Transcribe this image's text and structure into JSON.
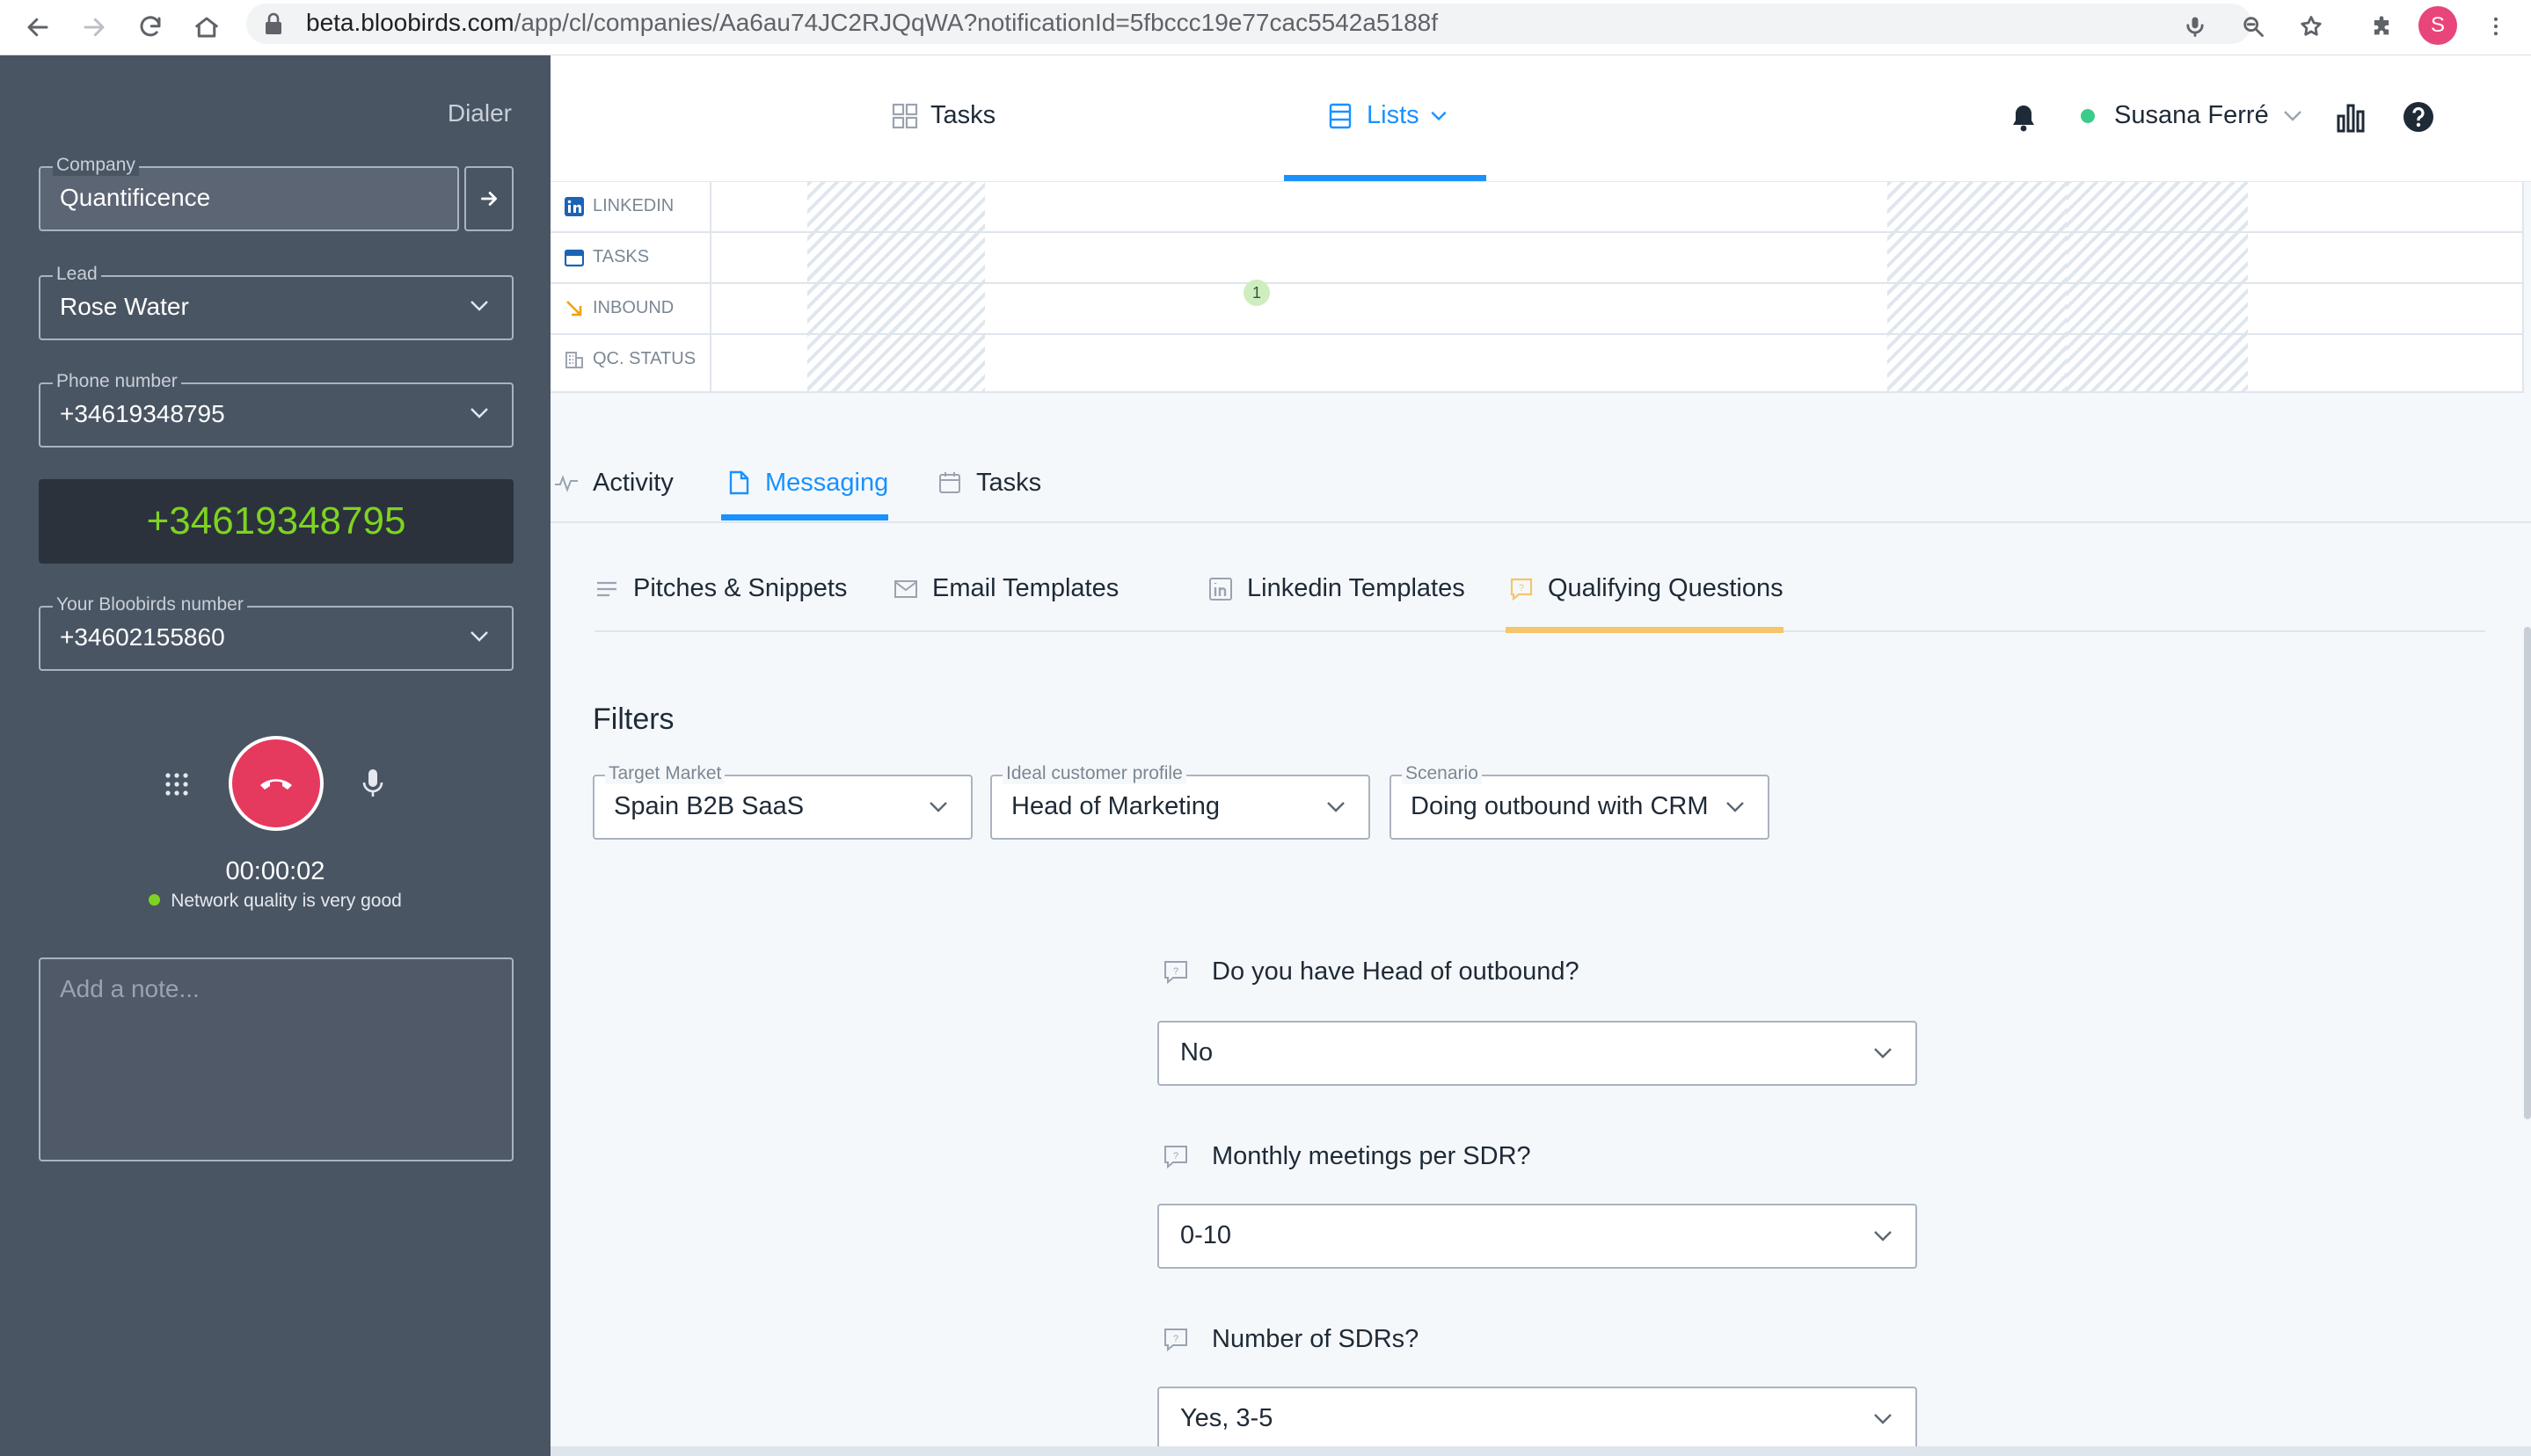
{
  "browser": {
    "url_host": "beta.bloobirds.com",
    "url_path": "/app/cl/companies/Aa6au74JC2RJQqWA?notificationId=5fbccc19e77cac5542a5188f",
    "profile_initial": "S"
  },
  "dialer": {
    "title": "Dialer",
    "company": {
      "label": "Company",
      "value": "Quantificence"
    },
    "lead": {
      "label": "Lead",
      "value": "Rose Water"
    },
    "phone": {
      "label": "Phone number",
      "value": "+34619348795"
    },
    "display_number": "+34619348795",
    "own_number": {
      "label": "Your Bloobirds number",
      "value": "+34602155860"
    },
    "timer": "00:00:02",
    "network_status": "Network quality is very good",
    "note_placeholder": "Add a note..."
  },
  "topnav": {
    "tasks_label": "Tasks",
    "lists_label": "Lists",
    "user_name": "Susana Ferré"
  },
  "timeline": {
    "rows": [
      "LINKEDIN",
      "TASKS",
      "INBOUND",
      "QC. STATUS"
    ],
    "badge": "1"
  },
  "content_tabs": {
    "activity": "Activity",
    "messaging": "Messaging",
    "tasks": "Tasks"
  },
  "sub_tabs": {
    "pitches": "Pitches & Snippets",
    "email": "Email Templates",
    "linkedin": "Linkedin Templates",
    "qualifying": "Qualifying Questions"
  },
  "filters": {
    "title": "Filters",
    "target_market": {
      "label": "Target Market",
      "value": "Spain B2B SaaS"
    },
    "icp": {
      "label": "Ideal customer profile",
      "value": "Head of Marketing"
    },
    "scenario": {
      "label": "Scenario",
      "value": "Doing outbound with CRM"
    }
  },
  "questions": [
    {
      "question": "Do you have Head of outbound?",
      "answer": "No"
    },
    {
      "question": "Monthly meetings per SDR?",
      "answer": "0-10"
    },
    {
      "question": "Number of SDRs?",
      "answer": "Yes, 3-5"
    }
  ],
  "colors": {
    "accent_blue": "#1991ff",
    "dialer_bg": "#4a5563",
    "number_green": "#7ed321",
    "hangup_red": "#e6395e",
    "qualifying_yellow": "#f4c56a"
  }
}
